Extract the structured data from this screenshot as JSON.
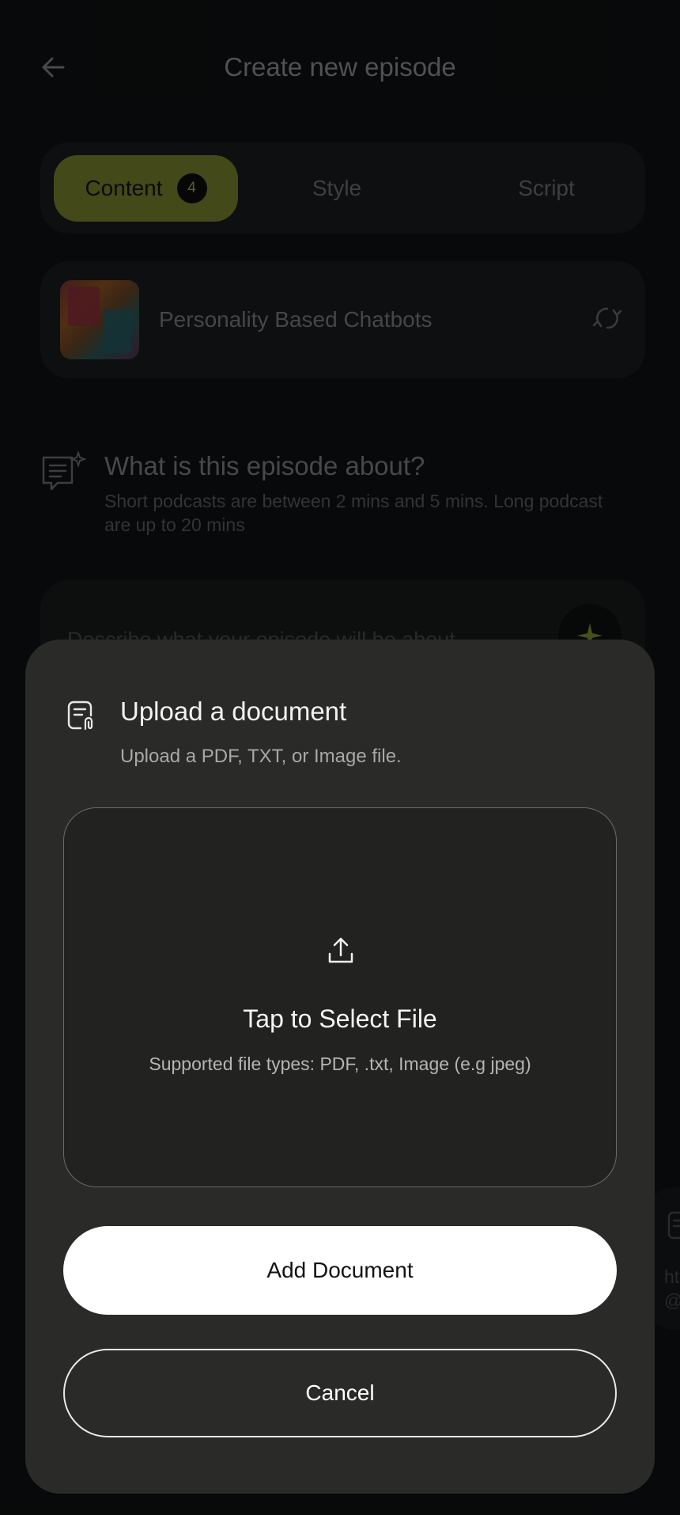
{
  "header": {
    "title": "Create new episode",
    "back_icon": "arrow-left-icon"
  },
  "tabs": [
    {
      "label": "Content",
      "badge": "4",
      "active": true
    },
    {
      "label": "Style",
      "active": false
    },
    {
      "label": "Script",
      "active": false
    }
  ],
  "topic": {
    "title": "Personality Based Chatbots",
    "refresh_icon": "refresh-icon"
  },
  "about": {
    "title": "What is this episode about?",
    "subtitle": "Short podcasts are between 2 mins and 5 mins. Long podcast are up to 20 mins",
    "placeholder": "Describe what your episode will be about"
  },
  "side_card": {
    "text_line1": "ht",
    "text_line2": "@"
  },
  "sheet": {
    "title": "Upload a document",
    "subtitle": "Upload a PDF, TXT, or Image file.",
    "drop_title": "Tap to Select File",
    "drop_subtitle": "Supported file types:  PDF, .txt, Image (e.g jpeg)",
    "add_label": "Add Document",
    "cancel_label": "Cancel"
  },
  "colors": {
    "accent": "#687026",
    "sheet_bg": "#2a2a29",
    "background": "#0d0f10"
  }
}
